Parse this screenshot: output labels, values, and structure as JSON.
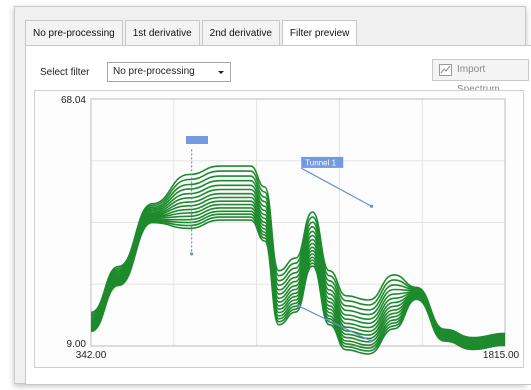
{
  "tabs": [
    {
      "label": "No pre-processing",
      "active": false
    },
    {
      "label": "1st derivative",
      "active": false
    },
    {
      "label": "2nd derivative",
      "active": false
    },
    {
      "label": "Filter preview",
      "active": true
    }
  ],
  "filter": {
    "label": "Select filter",
    "selected": "No pre-processing"
  },
  "import_button": {
    "label": "Import Spectrum",
    "icon": "chart-icon",
    "enabled": false
  },
  "colors": {
    "series": "#1e8a2e",
    "tunnel": "#6a8ed6",
    "tunnel_label_bg": "#7399e0"
  },
  "chart_data": {
    "type": "line",
    "xlim": [
      342.0,
      1815.0
    ],
    "ylim": [
      9.0,
      68.04
    ],
    "x_tick_labels": [
      "342.00",
      "1815.00"
    ],
    "y_tick_labels": [
      "68.04",
      "9.00"
    ],
    "grid": true,
    "annotations": [
      {
        "label": "Tunnel 1",
        "kind": "tunnel-segment"
      },
      {
        "label": "",
        "kind": "tunnel-segment"
      },
      {
        "label": "",
        "kind": "tunnel-segment"
      }
    ],
    "x": [
      342,
      440,
      560,
      690,
      800,
      910,
      960,
      1010,
      1070,
      1130,
      1190,
      1250,
      1330,
      1420,
      1500,
      1600,
      1700,
      1815
    ],
    "profile": [
      17,
      28,
      43,
      50,
      52,
      52,
      47,
      27,
      30,
      41,
      27,
      21,
      20,
      26,
      23,
      13,
      11,
      12
    ],
    "offsets": [
      0,
      -1.2,
      -2.4,
      -3.5,
      -4.6,
      -5.6,
      -6.6,
      -7.5,
      -8.4,
      -9.2,
      -10.0,
      -10.8,
      -11.5,
      -12.2,
      -12.9
    ]
  }
}
